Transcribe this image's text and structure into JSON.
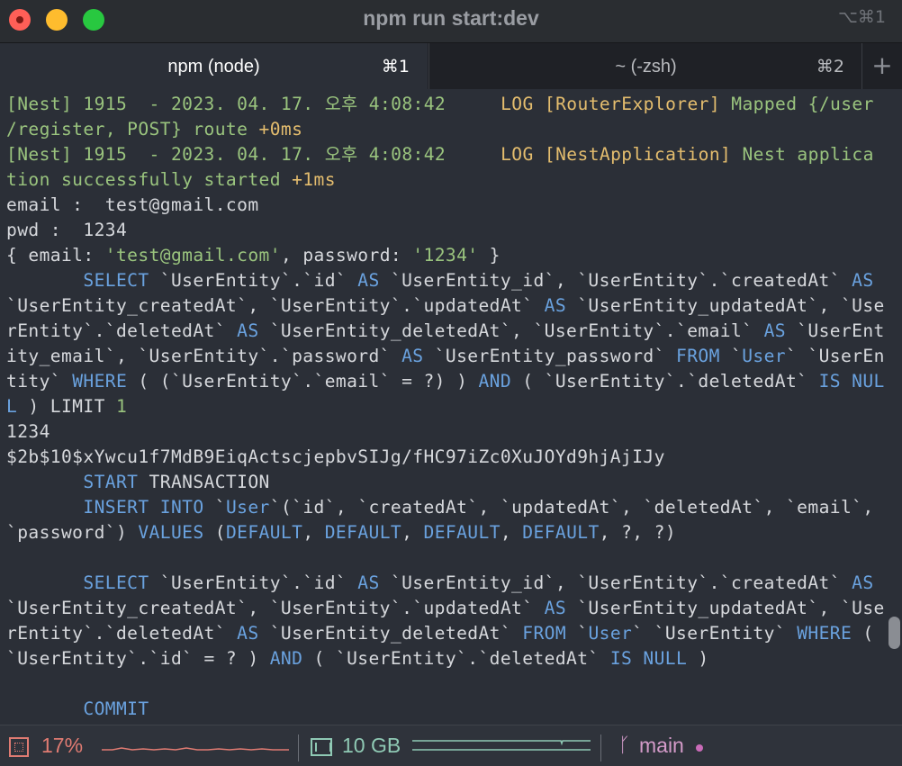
{
  "window": {
    "title": "npm run start:dev",
    "shortcut": "⌥⌘1"
  },
  "tabs": [
    {
      "label": "npm (node)",
      "key": "⌘1",
      "active": true
    },
    {
      "label": "~ (-zsh)",
      "key": "⌘2",
      "active": false
    }
  ],
  "new_tab_label": "+",
  "terminal": {
    "lines": [
      [
        [
          "g",
          "[Nest] 1915  - 2023. 04. 17. 오후 4:08:42     "
        ],
        [
          "y",
          "LOG "
        ],
        [
          "y",
          "[RouterExplorer] "
        ],
        [
          "g",
          "Mapped {/user"
        ]
      ],
      [
        [
          "g",
          "/register, POST} route "
        ],
        [
          "y",
          "+0ms"
        ]
      ],
      [
        [
          "g",
          "[Nest] 1915  - 2023. 04. 17. 오후 4:08:42     "
        ],
        [
          "y",
          "LOG "
        ],
        [
          "y",
          "[NestApplication] "
        ],
        [
          "g",
          "Nest applica"
        ]
      ],
      [
        [
          "g",
          "tion successfully started "
        ],
        [
          "y",
          "+1ms"
        ]
      ],
      [
        [
          "w",
          "email :  test@gmail.com"
        ]
      ],
      [
        [
          "w",
          "pwd :  1234"
        ]
      ],
      [
        [
          "w",
          "{ email: "
        ],
        [
          "s",
          "'test@gmail.com'"
        ],
        [
          "w",
          ", password: "
        ],
        [
          "s",
          "'1234'"
        ],
        [
          "w",
          " }"
        ]
      ],
      [
        [
          "w",
          "       "
        ],
        [
          "b",
          "SELECT"
        ],
        [
          "w",
          " `UserEntity`.`id` "
        ],
        [
          "b",
          "AS"
        ],
        [
          "w",
          " `UserEntity_id`, `UserEntity`.`createdAt` "
        ],
        [
          "b",
          "AS"
        ]
      ],
      [
        [
          "w",
          "`UserEntity_createdAt`, `UserEntity`.`updatedAt` "
        ],
        [
          "b",
          "AS"
        ],
        [
          "w",
          " `UserEntity_updatedAt`, `Use"
        ]
      ],
      [
        [
          "w",
          "rEntity`.`deletedAt` "
        ],
        [
          "b",
          "AS"
        ],
        [
          "w",
          " `UserEntity_deletedAt`, `UserEntity`.`email` "
        ],
        [
          "b",
          "AS"
        ],
        [
          "w",
          " `UserEnt"
        ]
      ],
      [
        [
          "w",
          "ity_email`, `UserEntity`.`password` "
        ],
        [
          "b",
          "AS"
        ],
        [
          "w",
          " `UserEntity_password` "
        ],
        [
          "b",
          "FROM"
        ],
        [
          "w",
          " `"
        ],
        [
          "b",
          "User"
        ],
        [
          "w",
          "` `UserEn"
        ]
      ],
      [
        [
          "w",
          "tity` "
        ],
        [
          "b",
          "WHERE"
        ],
        [
          "w",
          " ( (`UserEntity`.`email` = ?) ) "
        ],
        [
          "b",
          "AND"
        ],
        [
          "w",
          " ( `UserEntity`.`deletedAt` "
        ],
        [
          "b",
          "IS NUL"
        ]
      ],
      [
        [
          "b",
          "L"
        ],
        [
          "w",
          " ) LIMIT "
        ],
        [
          "n",
          "1"
        ]
      ],
      [
        [
          "w",
          "1234"
        ]
      ],
      [
        [
          "w",
          "$2b$10$xYwcu1f7MdB9EiqActscjepbvSIJg/fHC97iZc0XuJOYd9hjAjIJy"
        ]
      ],
      [
        [
          "w",
          "       "
        ],
        [
          "b",
          "START"
        ],
        [
          "w",
          " TRANSACTION"
        ]
      ],
      [
        [
          "w",
          "       "
        ],
        [
          "b",
          "INSERT INTO"
        ],
        [
          "w",
          " `"
        ],
        [
          "b",
          "User"
        ],
        [
          "w",
          "`(`id`, `createdAt`, `updatedAt`, `deletedAt`, `email`,"
        ]
      ],
      [
        [
          "w",
          "`password`) "
        ],
        [
          "b",
          "VALUES"
        ],
        [
          "w",
          " ("
        ],
        [
          "b",
          "DEFAULT"
        ],
        [
          "w",
          ", "
        ],
        [
          "b",
          "DEFAULT"
        ],
        [
          "w",
          ", "
        ],
        [
          "b",
          "DEFAULT"
        ],
        [
          "w",
          ", "
        ],
        [
          "b",
          "DEFAULT"
        ],
        [
          "w",
          ", ?, ?)"
        ]
      ],
      [
        [
          "w",
          ""
        ]
      ],
      [
        [
          "w",
          "       "
        ],
        [
          "b",
          "SELECT"
        ],
        [
          "w",
          " `UserEntity`.`id` "
        ],
        [
          "b",
          "AS"
        ],
        [
          "w",
          " `UserEntity_id`, `UserEntity`.`createdAt` "
        ],
        [
          "b",
          "AS"
        ]
      ],
      [
        [
          "w",
          "`UserEntity_createdAt`, `UserEntity`.`updatedAt` "
        ],
        [
          "b",
          "AS"
        ],
        [
          "w",
          " `UserEntity_updatedAt`, `Use"
        ]
      ],
      [
        [
          "w",
          "rEntity`.`deletedAt` "
        ],
        [
          "b",
          "AS"
        ],
        [
          "w",
          " `UserEntity_deletedAt` "
        ],
        [
          "b",
          "FROM"
        ],
        [
          "w",
          " `"
        ],
        [
          "b",
          "User"
        ],
        [
          "w",
          "` `UserEntity` "
        ],
        [
          "b",
          "WHERE"
        ],
        [
          "w",
          " ("
        ]
      ],
      [
        [
          "w",
          "`UserEntity`.`id` = ? ) "
        ],
        [
          "b",
          "AND"
        ],
        [
          "w",
          " ( `UserEntity`.`deletedAt` "
        ],
        [
          "b",
          "IS NULL"
        ],
        [
          "w",
          " )"
        ]
      ],
      [
        [
          "w",
          ""
        ]
      ],
      [
        [
          "w",
          "       "
        ],
        [
          "b",
          "COMMIT"
        ]
      ]
    ],
    "colors": {
      "background": "#2b2f37",
      "default_text": "#d6d8dc",
      "log_green": "#9ac47e",
      "log_yellow": "#e4bd6e",
      "sql_keyword_blue": "#6aa2df"
    }
  },
  "statusbar": {
    "cpu": {
      "icon": "cpu-icon",
      "value": "17%",
      "color": "#e07b72"
    },
    "memory": {
      "icon": "memory-icon",
      "value": "10 GB",
      "color": "#8fc9b4"
    },
    "git": {
      "icon": "branch-icon",
      "branch": "main",
      "color": "#d49bc9"
    }
  }
}
